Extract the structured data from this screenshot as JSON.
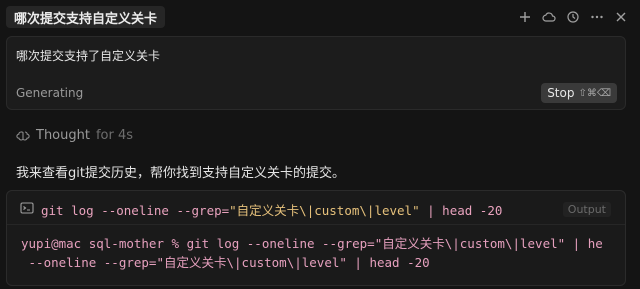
{
  "header": {
    "title": "哪次提交支持自定义关卡",
    "icons": [
      "plus-icon",
      "cloud-icon",
      "history-icon",
      "more-icon",
      "close-icon"
    ]
  },
  "prompt": {
    "text": "哪次提交支持了自定义关卡",
    "status": "Generating",
    "stop_label": "Stop",
    "stop_shortcut": "⇧⌘⌫"
  },
  "thought": {
    "label": "Thought",
    "duration": "for 4s"
  },
  "message": {
    "text": "我来查看git提交历史，帮你找到支持自定义关卡的提交。"
  },
  "terminal": {
    "command_prefix": "git log --oneline --grep=",
    "command_arg": "\"自定义关卡\\|custom\\|level\"",
    "command_suffix": " | head -20",
    "output_label": "Output",
    "output_line1": "yupi@mac sql-mother % git log --oneline --grep=\"自定义关卡\\|custom\\|level\" | he",
    "output_line2": " --oneline --grep=\"自定义关卡\\|custom\\|level\" | head -20"
  },
  "colors": {
    "background": "#141414",
    "card": "#1c1c1c",
    "command": "#e8a2bd",
    "string": "#e5c07b"
  }
}
